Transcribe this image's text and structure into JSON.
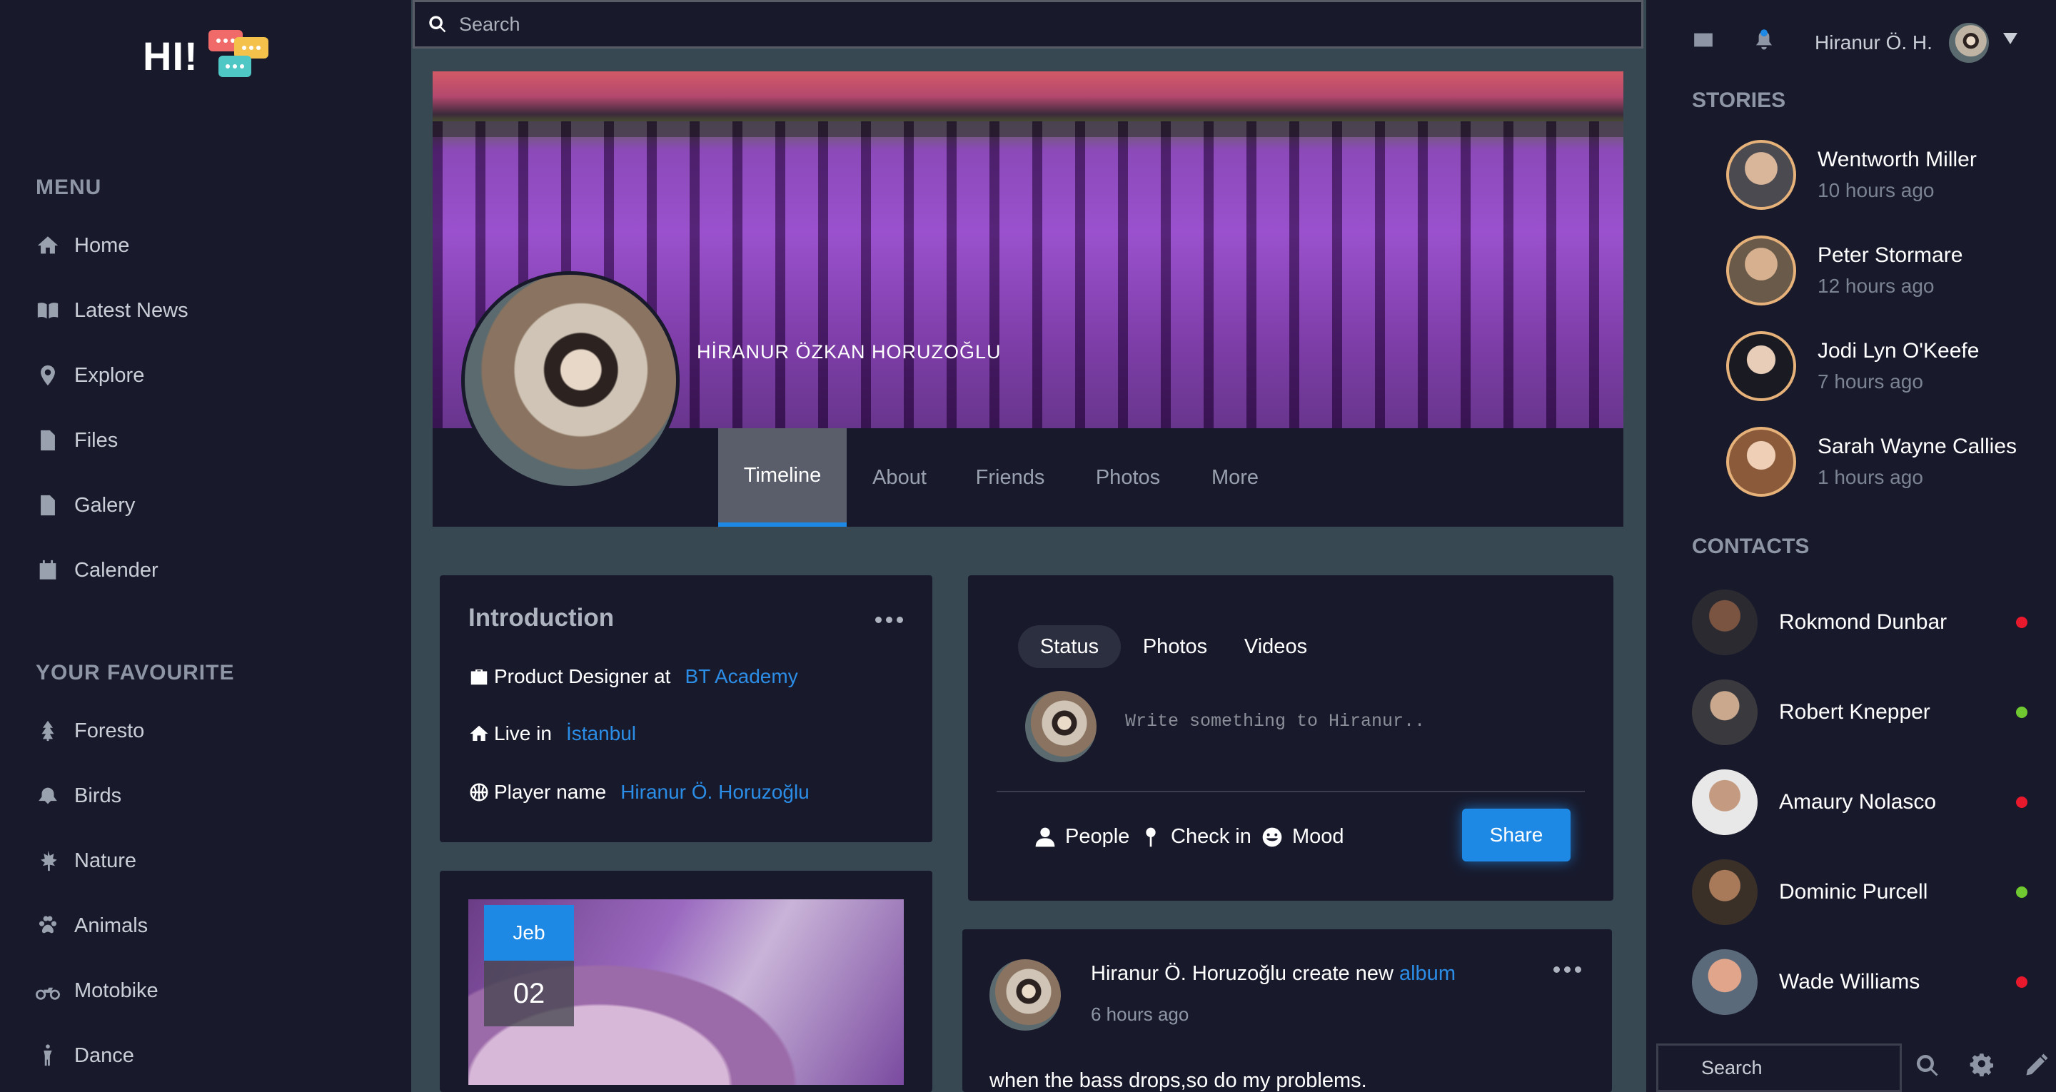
{
  "logo": {
    "text": "HI!"
  },
  "search": {
    "placeholder": "Search"
  },
  "menu": {
    "title": "MENU",
    "items": [
      {
        "label": "Home",
        "icon": "home-icon"
      },
      {
        "label": "Latest News",
        "icon": "book-icon"
      },
      {
        "label": "Explore",
        "icon": "map-pin-icon"
      },
      {
        "label": "Files",
        "icon": "file-icon"
      },
      {
        "label": "Galery",
        "icon": "image-file-icon"
      },
      {
        "label": "Calender",
        "icon": "calendar-icon"
      }
    ]
  },
  "favourite": {
    "title": "YOUR FAVOURITE",
    "items": [
      {
        "label": "Foresto",
        "icon": "tree-icon"
      },
      {
        "label": "Birds",
        "icon": "bird-icon"
      },
      {
        "label": "Nature",
        "icon": "leaf-icon"
      },
      {
        "label": "Animals",
        "icon": "paw-icon"
      },
      {
        "label": "Motobike",
        "icon": "motorcycle-icon"
      },
      {
        "label": "Dance",
        "icon": "dance-icon"
      }
    ]
  },
  "profile": {
    "name": "HİRANUR ÖZKAN HORUZOĞLU",
    "tabs": [
      "Timeline",
      "About",
      "Friends",
      "Photos",
      "More"
    ],
    "active_tab": "Timeline"
  },
  "intro": {
    "title": "Introduction",
    "job_prefix": "Product Designer at",
    "job_link": "BT Academy",
    "live_prefix": "Live in",
    "live_link": "İstanbul",
    "player_prefix": "Player name",
    "player_link": "Hiranur Ö. Horuzoğlu"
  },
  "photo_card": {
    "month": "Jeb",
    "day": "02"
  },
  "composer": {
    "tabs": [
      "Status",
      "Photos",
      "Videos"
    ],
    "active_tab": "Status",
    "placeholder": "Write something to Hiranur..",
    "actions": [
      "People",
      "Check in",
      "Mood"
    ],
    "share_label": "Share"
  },
  "post": {
    "author_text": "Hiranur Ö. Horuzoğlu create new",
    "author_link": "album",
    "time": "6 hours ago",
    "body": "when the bass drops,so do my problems."
  },
  "header_right": {
    "user_name": "Hiranur Ö. H."
  },
  "stories": {
    "title": "STORIES",
    "items": [
      {
        "name": "Wentworth Miller",
        "time": "10 hours ago"
      },
      {
        "name": "Peter Stormare",
        "time": "12 hours ago"
      },
      {
        "name": "Jodi Lyn O'Keefe",
        "time": "7 hours ago"
      },
      {
        "name": "Sarah Wayne Callies",
        "time": "1 hours ago"
      }
    ]
  },
  "contacts": {
    "title": "CONTACTS",
    "items": [
      {
        "name": "Rokmond Dunbar",
        "status_color": "#e8192c"
      },
      {
        "name": "Robert Knepper",
        "status_color": "#71c931"
      },
      {
        "name": "Amaury Nolasco",
        "status_color": "#e8192c"
      },
      {
        "name": "Dominic Purcell",
        "status_color": "#71c931"
      },
      {
        "name": "Wade Williams",
        "status_color": "#e8192c"
      }
    ]
  },
  "bottom_search": {
    "placeholder": "Search"
  },
  "colors": {
    "accent": "#1e88e5",
    "sidebar_bg": "#181a2c",
    "page_bg": "#374852"
  }
}
